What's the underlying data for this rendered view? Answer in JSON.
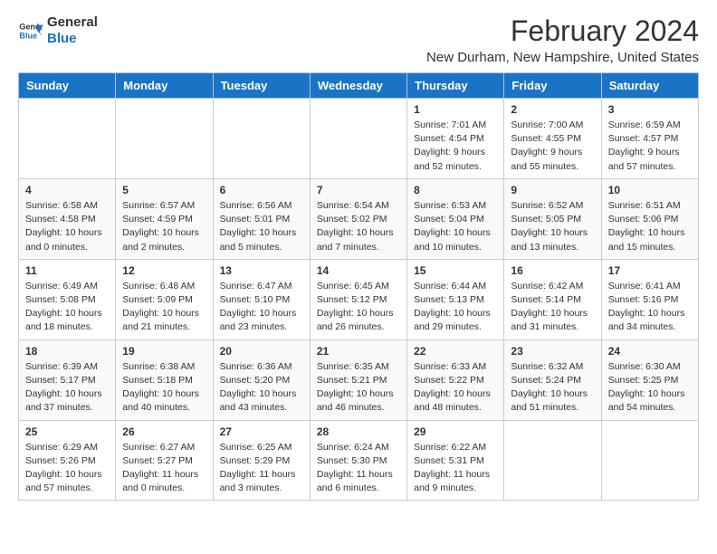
{
  "logo": {
    "line1": "General",
    "line2": "Blue"
  },
  "title": "February 2024",
  "subtitle": "New Durham, New Hampshire, United States",
  "days_of_week": [
    "Sunday",
    "Monday",
    "Tuesday",
    "Wednesday",
    "Thursday",
    "Friday",
    "Saturday"
  ],
  "weeks": [
    [
      {
        "day": "",
        "info": ""
      },
      {
        "day": "",
        "info": ""
      },
      {
        "day": "",
        "info": ""
      },
      {
        "day": "",
        "info": ""
      },
      {
        "day": "1",
        "info": "Sunrise: 7:01 AM\nSunset: 4:54 PM\nDaylight: 9 hours\nand 52 minutes."
      },
      {
        "day": "2",
        "info": "Sunrise: 7:00 AM\nSunset: 4:55 PM\nDaylight: 9 hours\nand 55 minutes."
      },
      {
        "day": "3",
        "info": "Sunrise: 6:59 AM\nSunset: 4:57 PM\nDaylight: 9 hours\nand 57 minutes."
      }
    ],
    [
      {
        "day": "4",
        "info": "Sunrise: 6:58 AM\nSunset: 4:58 PM\nDaylight: 10 hours\nand 0 minutes."
      },
      {
        "day": "5",
        "info": "Sunrise: 6:57 AM\nSunset: 4:59 PM\nDaylight: 10 hours\nand 2 minutes."
      },
      {
        "day": "6",
        "info": "Sunrise: 6:56 AM\nSunset: 5:01 PM\nDaylight: 10 hours\nand 5 minutes."
      },
      {
        "day": "7",
        "info": "Sunrise: 6:54 AM\nSunset: 5:02 PM\nDaylight: 10 hours\nand 7 minutes."
      },
      {
        "day": "8",
        "info": "Sunrise: 6:53 AM\nSunset: 5:04 PM\nDaylight: 10 hours\nand 10 minutes."
      },
      {
        "day": "9",
        "info": "Sunrise: 6:52 AM\nSunset: 5:05 PM\nDaylight: 10 hours\nand 13 minutes."
      },
      {
        "day": "10",
        "info": "Sunrise: 6:51 AM\nSunset: 5:06 PM\nDaylight: 10 hours\nand 15 minutes."
      }
    ],
    [
      {
        "day": "11",
        "info": "Sunrise: 6:49 AM\nSunset: 5:08 PM\nDaylight: 10 hours\nand 18 minutes."
      },
      {
        "day": "12",
        "info": "Sunrise: 6:48 AM\nSunset: 5:09 PM\nDaylight: 10 hours\nand 21 minutes."
      },
      {
        "day": "13",
        "info": "Sunrise: 6:47 AM\nSunset: 5:10 PM\nDaylight: 10 hours\nand 23 minutes."
      },
      {
        "day": "14",
        "info": "Sunrise: 6:45 AM\nSunset: 5:12 PM\nDaylight: 10 hours\nand 26 minutes."
      },
      {
        "day": "15",
        "info": "Sunrise: 6:44 AM\nSunset: 5:13 PM\nDaylight: 10 hours\nand 29 minutes."
      },
      {
        "day": "16",
        "info": "Sunrise: 6:42 AM\nSunset: 5:14 PM\nDaylight: 10 hours\nand 31 minutes."
      },
      {
        "day": "17",
        "info": "Sunrise: 6:41 AM\nSunset: 5:16 PM\nDaylight: 10 hours\nand 34 minutes."
      }
    ],
    [
      {
        "day": "18",
        "info": "Sunrise: 6:39 AM\nSunset: 5:17 PM\nDaylight: 10 hours\nand 37 minutes."
      },
      {
        "day": "19",
        "info": "Sunrise: 6:38 AM\nSunset: 5:18 PM\nDaylight: 10 hours\nand 40 minutes."
      },
      {
        "day": "20",
        "info": "Sunrise: 6:36 AM\nSunset: 5:20 PM\nDaylight: 10 hours\nand 43 minutes."
      },
      {
        "day": "21",
        "info": "Sunrise: 6:35 AM\nSunset: 5:21 PM\nDaylight: 10 hours\nand 46 minutes."
      },
      {
        "day": "22",
        "info": "Sunrise: 6:33 AM\nSunset: 5:22 PM\nDaylight: 10 hours\nand 48 minutes."
      },
      {
        "day": "23",
        "info": "Sunrise: 6:32 AM\nSunset: 5:24 PM\nDaylight: 10 hours\nand 51 minutes."
      },
      {
        "day": "24",
        "info": "Sunrise: 6:30 AM\nSunset: 5:25 PM\nDaylight: 10 hours\nand 54 minutes."
      }
    ],
    [
      {
        "day": "25",
        "info": "Sunrise: 6:29 AM\nSunset: 5:26 PM\nDaylight: 10 hours\nand 57 minutes."
      },
      {
        "day": "26",
        "info": "Sunrise: 6:27 AM\nSunset: 5:27 PM\nDaylight: 11 hours\nand 0 minutes."
      },
      {
        "day": "27",
        "info": "Sunrise: 6:25 AM\nSunset: 5:29 PM\nDaylight: 11 hours\nand 3 minutes."
      },
      {
        "day": "28",
        "info": "Sunrise: 6:24 AM\nSunset: 5:30 PM\nDaylight: 11 hours\nand 6 minutes."
      },
      {
        "day": "29",
        "info": "Sunrise: 6:22 AM\nSunset: 5:31 PM\nDaylight: 11 hours\nand 9 minutes."
      },
      {
        "day": "",
        "info": ""
      },
      {
        "day": "",
        "info": ""
      }
    ]
  ]
}
